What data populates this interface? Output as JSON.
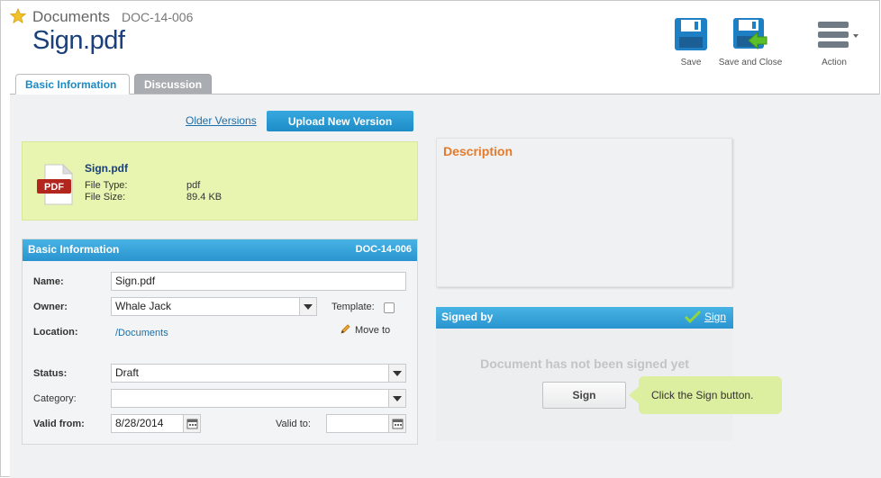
{
  "header": {
    "breadcrumb": "Documents",
    "doc_id": "DOC-14-006",
    "title": "Sign.pdf"
  },
  "toolbar": {
    "save_label": "Save",
    "save_close_label": "Save and Close",
    "action_label": "Action"
  },
  "tabs": [
    {
      "label": "Basic Information",
      "active": true
    },
    {
      "label": "Discussion",
      "active": false
    }
  ],
  "versions": {
    "older_label": "Older Versions",
    "upload_label": "Upload New Version"
  },
  "file": {
    "icon_text": "PDF",
    "name": "Sign.pdf",
    "type_label": "File Type:",
    "type_value": "pdf",
    "size_label": "File Size:",
    "size_value": "89.4 KB"
  },
  "basic_info": {
    "title": "Basic Information",
    "id": "DOC-14-006",
    "name_label": "Name:",
    "name_value": "Sign.pdf",
    "owner_label": "Owner:",
    "owner_value": "Whale Jack",
    "template_label": "Template:",
    "location_label": "Location:",
    "location_value": "/Documents",
    "move_to_label": "Move to",
    "status_label": "Status:",
    "status_value": "Draft",
    "category_label": "Category:",
    "category_value": "",
    "valid_from_label": "Valid from:",
    "valid_from_value": "8/28/2014",
    "valid_to_label": "Valid to:",
    "valid_to_value": ""
  },
  "description": {
    "title": "Description"
  },
  "signed_by": {
    "title": "Signed by",
    "sign_link": "Sign",
    "empty_text": "Document has not been signed yet",
    "sign_button": "Sign",
    "tooltip": "Click the Sign button."
  },
  "colors": {
    "accent_blue": "#2994cf",
    "title_blue": "#1a3f7a",
    "description_orange": "#e57a2b",
    "file_card_green": "#e7f5b0",
    "tooltip_green": "#dceea0"
  }
}
